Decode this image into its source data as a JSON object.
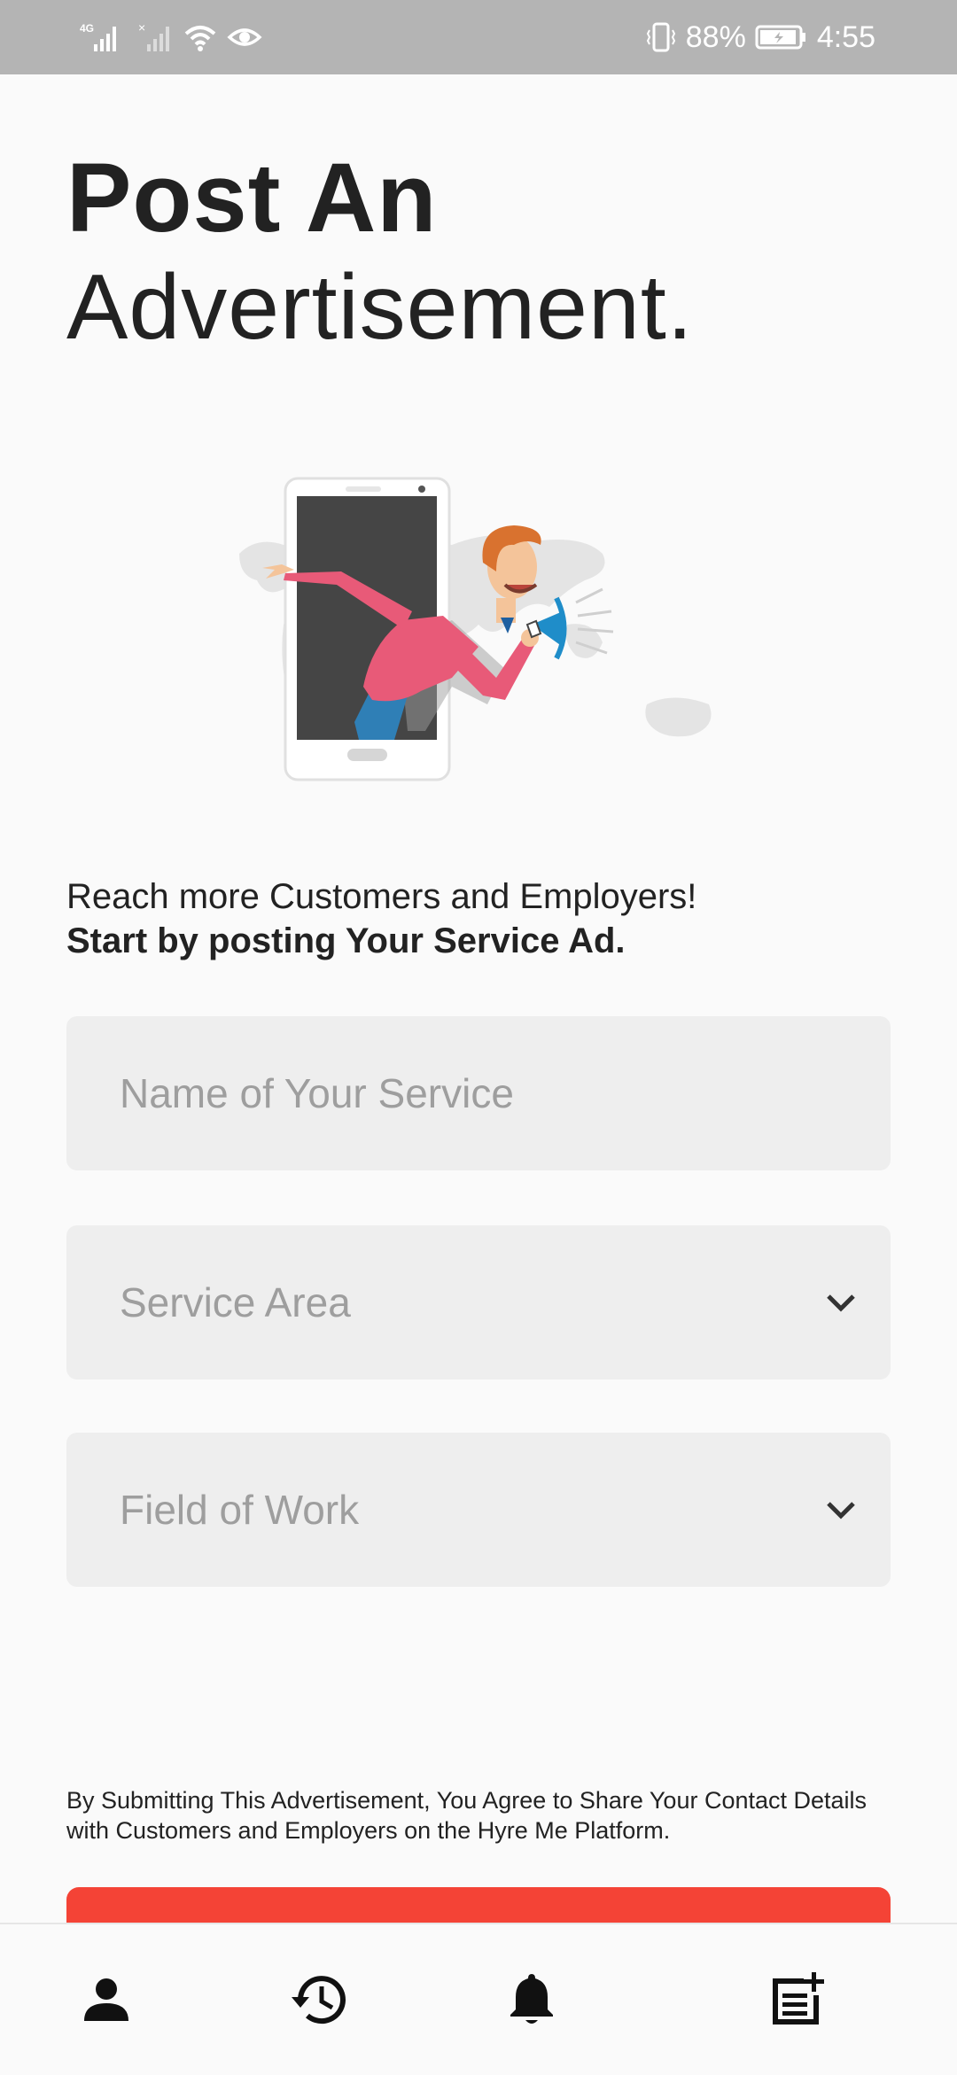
{
  "status_bar": {
    "network": "4G",
    "battery": "88%",
    "time": "4:55"
  },
  "page": {
    "title_bold": "Post An",
    "title_light": "Advertisement.",
    "tagline": "Reach more Customers and Employers!",
    "tagline_bold": "Start by posting Your Service Ad."
  },
  "form": {
    "service_name_placeholder": "Name of Your Service",
    "service_area_placeholder": "Service Area",
    "field_of_work_placeholder": "Field of Work"
  },
  "disclaimer": "By Submitting This Advertisement, You Agree to Share Your Contact Details with Customers and Employers on the Hyre Me Platform.",
  "colors": {
    "accent": "#f44336",
    "status_bar": "#b4b4b4",
    "field_bg": "#eeeeee",
    "illustration_shirt": "#e85a78"
  },
  "bottom_nav": [
    {
      "icon": "person-icon"
    },
    {
      "icon": "history-icon"
    },
    {
      "icon": "bell-icon"
    },
    {
      "icon": "post-add-icon"
    }
  ]
}
